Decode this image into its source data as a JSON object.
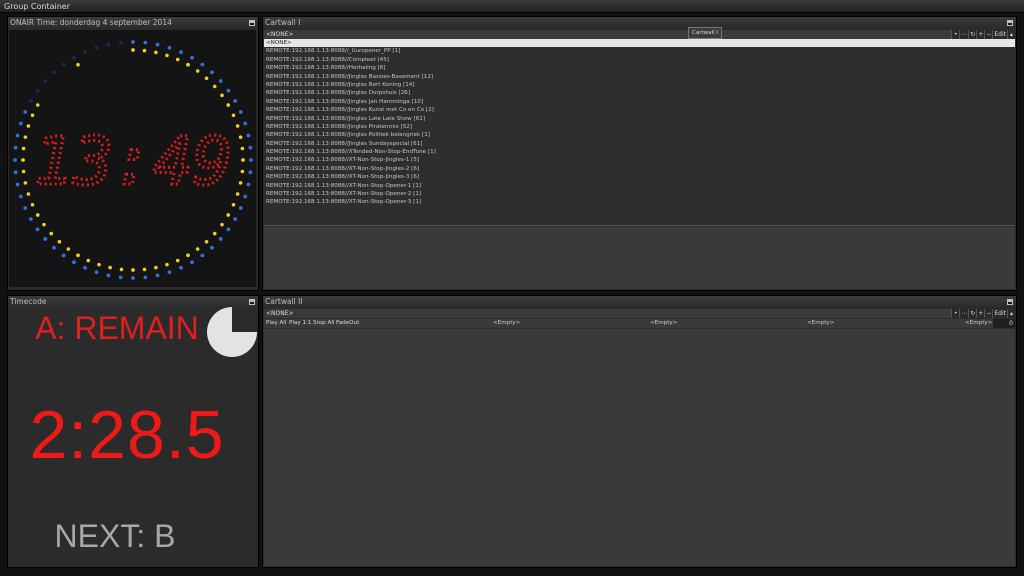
{
  "window": {
    "title": "Group Container"
  },
  "clock_panel": {
    "title": "ONAIR Time: donderdag 4 september 2014",
    "time": "13:49",
    "seconds_elapsed": 49,
    "colors": {
      "digits": "#e01b1b",
      "seconds_lit": "#f0d020",
      "seconds_dim": "#2f6fe0"
    }
  },
  "timecode_panel": {
    "title": "Timecode",
    "label": "A: REMAIN",
    "time": "2:28.5",
    "next": "NEXT: B",
    "pie_fraction": 0.75
  },
  "cartwall1": {
    "title": "Cartwall I",
    "selector": "<NONE>",
    "tooltip": "Cartwall I",
    "tools": [
      "•",
      "⋯",
      "↻",
      "+",
      "−",
      "Edit",
      "▴"
    ],
    "items": [
      "<NONE>",
      "REMOTE:192.168.1.13:8088//_Uuropener_PP [1]",
      "REMOTE:192.168.1.13:8088//Compleet [45]",
      "REMOTE:192.168.1.13:8088//Herhaling [6]",
      "REMOTE:192.168.1.13:8088//Jingles Bassies-Basement [12]",
      "REMOTE:192.168.1.13:8088//Jingles Bert Koning [14]",
      "REMOTE:192.168.1.13:8088//Jingles Dorpshuis [26]",
      "REMOTE:192.168.1.13:8088//Jingles Jan Hamminga [10]",
      "REMOTE:192.168.1.13:8088//Jingles Kunst met Co en Co [2]",
      "REMOTE:192.168.1.13:8088//Jingles Late Late Show [61]",
      "REMOTE:192.168.1.13:8088//Jingles Piratenmix [52]",
      "REMOTE:192.168.1.13:8088//Jingles Politiek belangriek [1]",
      "REMOTE:192.168.1.13:8088//Jingles Sundayspecial [61]",
      "REMOTE:192.168.1.13:8088//XTended-Non-Stop-EndTune [1]",
      "REMOTE:192.168.1.13:8088//XT-Non-Stop-Jingles-1 [5]",
      "REMOTE:192.168.1.13:8088//XT-Non-Stop-Jingles-2 [6]",
      "REMOTE:192.168.1.13:8088//XT-Non-Stop-Jingles-3 [6]",
      "REMOTE:192.168.1.13:8088//XT-Non-Stop-Opener-1 [1]",
      "REMOTE:192.168.1.13:8088//XT-Non-Stop-Opener-2 [1]",
      "REMOTE:192.168.1.13:8088//XT-Non-Stop-Opener-3 [1]"
    ]
  },
  "cartwall2": {
    "title": "Cartwall II",
    "selector": "<NONE>",
    "tools": [
      "•",
      "⋯",
      "↻",
      "+",
      "−",
      "Edit",
      "▴"
    ],
    "buttons": {
      "play_all": "Play All",
      "play_11": "Play 1:1",
      "stop_all": "Stop All",
      "fadeout": "FadeOut"
    },
    "slots": [
      "<Empty>",
      "<Empty>",
      "<Empty>",
      "<Empty>"
    ],
    "counter": "0"
  }
}
